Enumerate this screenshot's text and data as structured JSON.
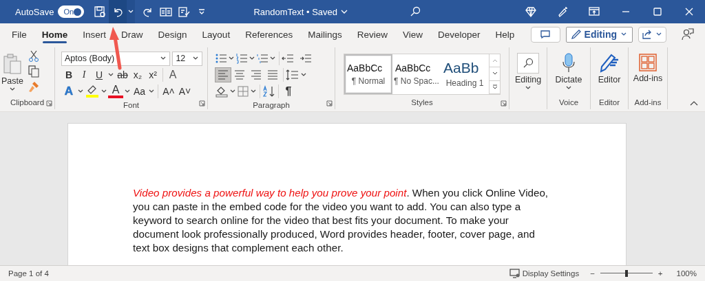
{
  "title_bar": {
    "autosave_label": "AutoSave",
    "autosave": {
      "label": "On",
      "on": true
    },
    "undo_highlighted": true,
    "document_title": "RandomText • Saved"
  },
  "tabs": [
    {
      "label": "File",
      "selected": false
    },
    {
      "label": "Home",
      "selected": true
    },
    {
      "label": "Insert",
      "selected": false
    },
    {
      "label": "Draw",
      "selected": false
    },
    {
      "label": "Design",
      "selected": false
    },
    {
      "label": "Layout",
      "selected": false
    },
    {
      "label": "References",
      "selected": false
    },
    {
      "label": "Mailings",
      "selected": false
    },
    {
      "label": "Review",
      "selected": false
    },
    {
      "label": "View",
      "selected": false
    },
    {
      "label": "Developer",
      "selected": false
    },
    {
      "label": "Help",
      "selected": false
    }
  ],
  "editing_mode_button": "Editing",
  "ribbon": {
    "clipboard": {
      "label": "Clipboard",
      "paste": "Paste"
    },
    "font": {
      "label": "Font",
      "font_name": "Aptos (Body)",
      "font_size": "12",
      "format_buttons": [
        {
          "label": "B",
          "kind": "bold"
        },
        {
          "label": "I",
          "kind": "italic"
        },
        {
          "label": "U",
          "kind": "underline"
        },
        {
          "label": "ab",
          "kind": "strike"
        },
        {
          "label": "x₂",
          "kind": "plain"
        },
        {
          "label": "x²",
          "kind": "plain"
        },
        {
          "label": "A",
          "kind": "clear"
        }
      ],
      "effect_buttons": [
        {
          "label": "A",
          "kind": "effects"
        },
        {
          "kind": "highlight"
        },
        {
          "label": "A",
          "kind": "fontcolor"
        },
        {
          "label": "Aa",
          "kind": "plain"
        },
        {
          "label": "A˄",
          "kind": "plain"
        },
        {
          "label": "A˅",
          "kind": "plain"
        }
      ]
    },
    "paragraph": {
      "label": "Paragraph",
      "align_buttons": [
        {
          "selected": true
        },
        {
          "selected": false
        },
        {
          "selected": false
        },
        {
          "selected": false
        }
      ],
      "pilcrow": "¶"
    },
    "styles": {
      "label": "Styles",
      "items": [
        {
          "preview": "AaBbCc",
          "name": "¶ Normal",
          "kind": "body",
          "selected": true
        },
        {
          "preview": "AaBbCc",
          "name": "¶ No Spac...",
          "kind": "body",
          "selected": false
        },
        {
          "preview": "AaBb",
          "name": "Heading 1",
          "kind": "heading",
          "selected": false
        }
      ]
    },
    "editing": {
      "button": "Editing"
    },
    "voice": {
      "label": "Voice",
      "button": "Dictate"
    },
    "editor": {
      "label": "Editor",
      "button": "Editor"
    },
    "addins": {
      "label": "Add-ins",
      "button": "Add-ins"
    }
  },
  "document": {
    "paragraph": "*Video provides a powerful way to help you prove your point*. When you click Online Video, you can paste in the embed code for the video you want to add. You can also type a keyword to search online for the video that best fits your document. To make your document look professionally produced, Word provides header, footer, cover page, and text box designs that complement each other."
  },
  "status_bar": {
    "page": "Page 1 of 4",
    "display_settings": "Display Settings",
    "zoom_out": "−",
    "zoom_in": "+",
    "zoom": {
      "level": 0.5
    },
    "zoom_percent": "100%"
  }
}
